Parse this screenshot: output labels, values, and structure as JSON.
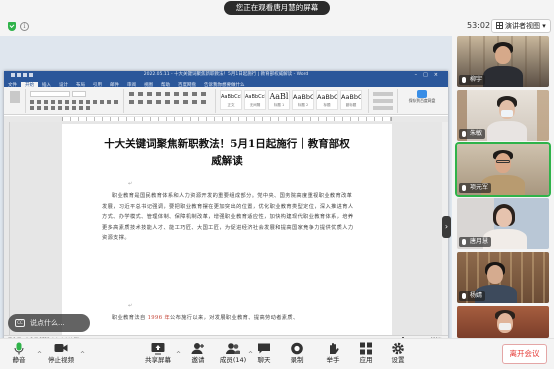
{
  "meeting": {
    "viewing_banner": "您正在观看唐月慧的屏幕",
    "timer": "53:02",
    "view_button": "演讲者视图"
  },
  "word": {
    "title_bar": "2022.05.11 - 十大关键词聚焦新职教法！5月1日起施行 | 教育部权威解读 - Word",
    "tabs": [
      "文件",
      "开始",
      "插入",
      "设计",
      "布局",
      "引用",
      "邮件",
      "审阅",
      "视图",
      "帮助",
      "百度网盘",
      "告诉我你想要做什么"
    ],
    "styles": [
      {
        "sample": "AaBbCcDd",
        "name": "正文"
      },
      {
        "sample": "AaBbCcDd",
        "name": "无间隔"
      },
      {
        "sample": "AaBl",
        "name": "标题 1"
      },
      {
        "sample": "AaBbC",
        "name": "标题 2"
      },
      {
        "sample": "AaBbC",
        "name": "标题"
      },
      {
        "sample": "AaBbC",
        "name": "副标题"
      }
    ],
    "ribbon_right_label": "保存到百度网盘",
    "doc_title": "十大关键词聚焦新职教法！5月1日起施行｜教育部权威解读",
    "paragraph1": "职业教育是国民教育体系和人力资源开发的重要组成部分。党中央、国务院高度重视职业教育改革发展，习近平总书记强调，要把职业教育摆在更加突出的位置，优化职业教育类型定位，深入推进育人方式、办学模式、管理体制、保障机制改革，增强职业教育适应性，加快构建现代职业教育体系，培养更多高素质技术技能人才、能工巧匠、大国工匠，为促进经济社会发展和提高国家竞争力提供优质人力资源支撑。",
    "paragraph2_start": "职业教育法自",
    "paragraph2_year": "1996 年",
    "paragraph2_end": "公布施行以来，对发展职业教育、提高劳动者素质、",
    "status_left": "第 1 页，共 5 页   2723 个字   中文(中国)",
    "zoom": "121%"
  },
  "subtitle_pill": "说点什么...",
  "participants": [
    {
      "name": "柳宇"
    },
    {
      "name": "朱敏"
    },
    {
      "name": "项元军"
    },
    {
      "name": "唐月慧"
    },
    {
      "name": "杨婧"
    },
    {
      "name": ""
    }
  ],
  "toolbar": {
    "mute": "静音",
    "stop_video": "停止视频",
    "share_screen": "共享屏幕",
    "invite": "邀请",
    "members": "成员(14)",
    "chat": "聊天",
    "record": "录制",
    "raise_hand": "举手",
    "apps": "应用",
    "settings": "设置",
    "leave": "离开会议"
  },
  "colors": {
    "word_blue": "#2b579a",
    "active_speaker": "#2fb34a",
    "leave_red": "#e53935",
    "doc_year_red": "#c0392b"
  }
}
